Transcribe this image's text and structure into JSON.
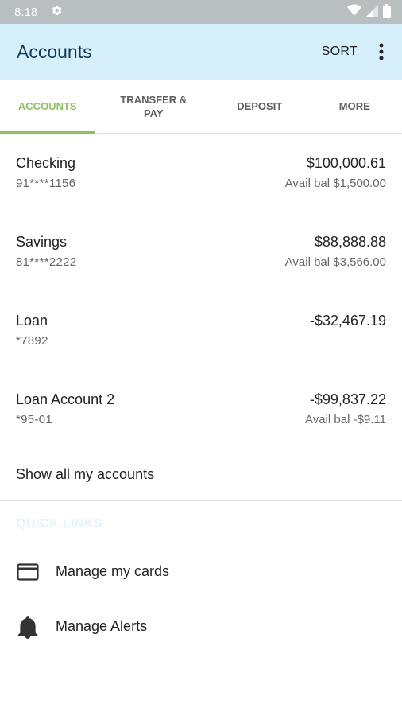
{
  "status": {
    "time": "8:18",
    "icons": [
      "gear-icon",
      "wifi-icon",
      "signal-icon",
      "battery-icon"
    ]
  },
  "header": {
    "title": "Accounts",
    "sort_label": "SORT",
    "menu_icon": "more-vert-icon"
  },
  "tabs": [
    {
      "label": "ACCOUNTS",
      "active": true
    },
    {
      "label": "TRANSFER & PAY",
      "active": false
    },
    {
      "label": "DEPOSIT",
      "active": false
    },
    {
      "label": "MORE",
      "active": false
    }
  ],
  "accounts": [
    {
      "name": "Checking",
      "number": "91****1156",
      "balance": "$100,000.61",
      "avail": "Avail bal $1,500.00"
    },
    {
      "name": "Savings",
      "number": "81****2222",
      "balance": "$88,888.88",
      "avail": "Avail bal $3,566.00"
    },
    {
      "name": "Loan",
      "number": "*7892",
      "balance": "-$32,467.19",
      "avail": ""
    },
    {
      "name": "Loan Account 2",
      "number": "*95-01",
      "balance": "-$99,837.22",
      "avail": "Avail bal -$9.11"
    }
  ],
  "show_all_label": "Show all my accounts",
  "quick_links": {
    "title": "QUICK LINKS",
    "items": [
      {
        "label": "Manage my cards",
        "icon": "credit-card-icon"
      },
      {
        "label": "Manage Alerts",
        "icon": "bell-icon"
      }
    ]
  },
  "colors": {
    "status_bar": "#b9bec1",
    "app_bar": "#d6f0fb",
    "title_text": "#123a5c",
    "active_tab": "#8cc45a",
    "quick_links_title": "#e2f3fb"
  }
}
